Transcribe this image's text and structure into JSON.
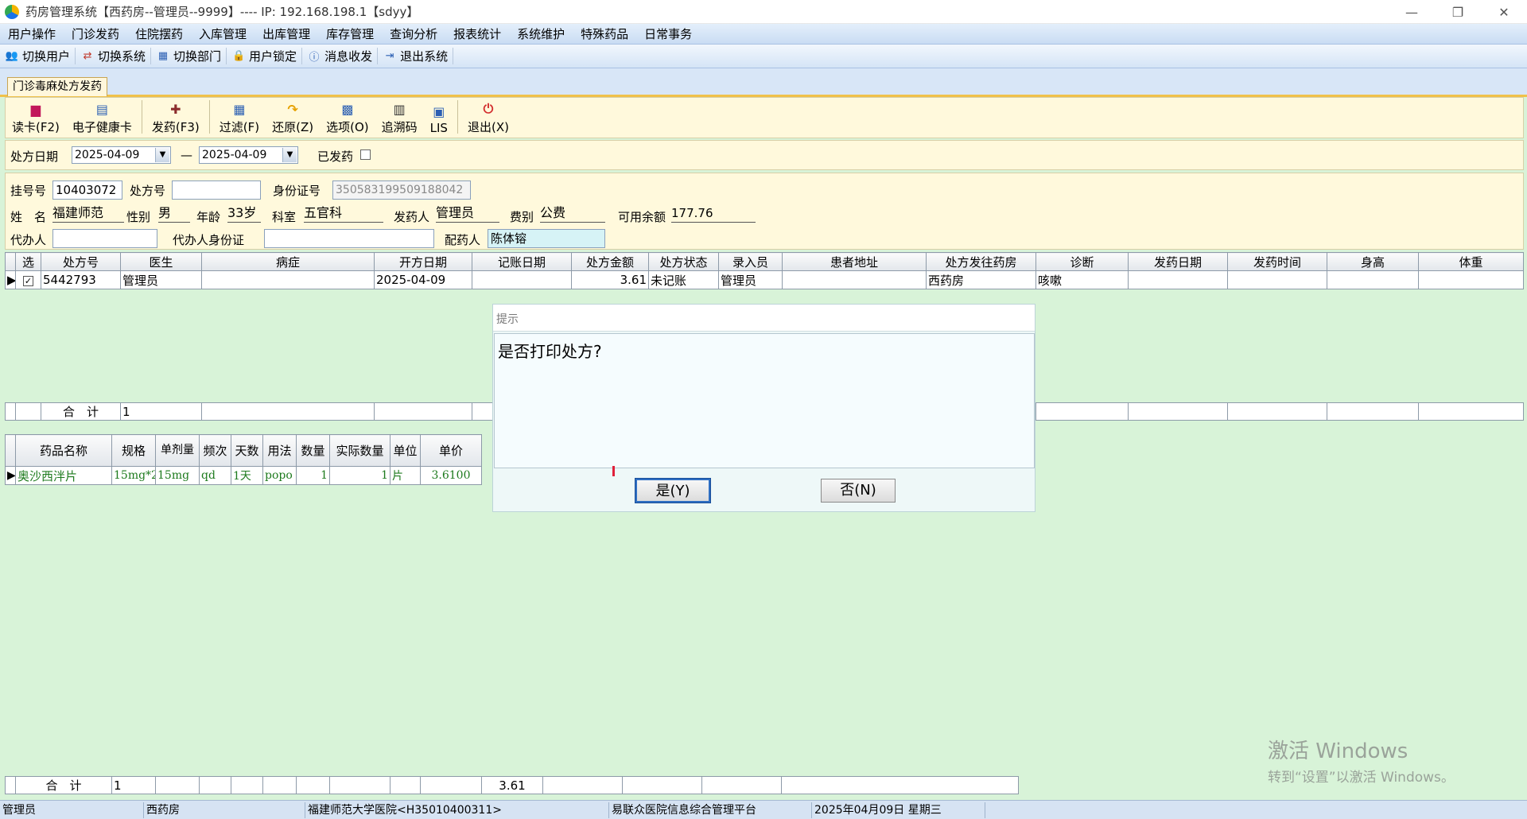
{
  "window": {
    "title": "药房管理系统【西药房--管理员--9999】---- IP: 192.168.198.1【sdyy】",
    "min": "—",
    "restore": "❐",
    "close": "✕"
  },
  "menu": [
    "用户操作",
    "门诊发药",
    "住院摆药",
    "入库管理",
    "出库管理",
    "库存管理",
    "查询分析",
    "报表统计",
    "系统维护",
    "特殊药品",
    "日常事务"
  ],
  "toolbar": [
    {
      "label": "切换用户",
      "icon": "users-icon"
    },
    {
      "label": "切换系统",
      "icon": "switch-system-icon"
    },
    {
      "label": "切换部门",
      "icon": "department-icon"
    },
    {
      "label": "用户锁定",
      "icon": "lock-user-icon"
    },
    {
      "label": "消息收发",
      "icon": "info-icon"
    },
    {
      "label": "退出系统",
      "icon": "exit-icon"
    }
  ],
  "tab": {
    "label": "门诊毒麻处方发药"
  },
  "actions": [
    {
      "label": "读卡(F2)",
      "icon": "card-reader-icon",
      "glyph": "▆",
      "color": "#c2185b"
    },
    {
      "label": "电子健康卡",
      "icon": "health-card-icon",
      "glyph": "▤",
      "color": "#2b5fb3"
    },
    {
      "label": "发药(F3)",
      "icon": "dispense-icon",
      "glyph": "✚",
      "color": "#8b2c2c"
    },
    {
      "label": "过滤(F)",
      "icon": "filter-icon",
      "glyph": "▦",
      "color": "#2b5fb3"
    },
    {
      "label": "还原(Z)",
      "icon": "restore-icon",
      "glyph": "↷",
      "color": "#e6a100"
    },
    {
      "label": "选项(O)",
      "icon": "options-icon",
      "glyph": "▩",
      "color": "#2b5fb3"
    },
    {
      "label": "追溯码",
      "icon": "barcode-icon",
      "glyph": "▥",
      "color": "#333"
    },
    {
      "label": "LIS",
      "icon": "lis-icon",
      "glyph": "▣",
      "color": "#2b5fb3"
    },
    {
      "label": "退出(X)",
      "icon": "power-icon",
      "glyph": "⏻",
      "color": "#d32f2f"
    }
  ],
  "filter": {
    "date_label": "处方日期",
    "date_from": "2025-04-09",
    "dash": "—",
    "date_to": "2025-04-09",
    "dispensed_label": "已发药"
  },
  "patient": {
    "reg_label": "挂号号",
    "reg_no": "10403072",
    "rx_label": "处方号",
    "rx_no": "",
    "id_label": "身份证号",
    "id_no": "350583199509188042",
    "name_label": "姓　名",
    "name": "福建师范",
    "sex_label": "性别",
    "sex": "男",
    "age_label": "年龄",
    "age": "33岁",
    "dept_label": "科室",
    "dept": "五官科",
    "dispenser_label": "发药人",
    "dispenser": "管理员",
    "fee_label": "费别",
    "fee": "公费",
    "balance_label": "可用余额",
    "balance": "177.76",
    "agent_label": "代办人",
    "agent": "",
    "agent_id_label": "代办人身份证",
    "agent_id": "",
    "pharmacist_label": "配药人",
    "pharmacist": "陈体镕"
  },
  "rx_table": {
    "headers": [
      "选",
      "处方号",
      "医生",
      "病症",
      "开方日期",
      "记账日期",
      "处方金额",
      "处方状态",
      "录入员",
      "患者地址",
      "处方发往药房",
      "诊断",
      "发药日期",
      "发药时间",
      "身高",
      "体重"
    ],
    "rows": [
      {
        "selected": "✓",
        "rx_no": "5442793",
        "doctor": "管理员",
        "disease": "",
        "open_date": "2025-04-09",
        "acct_date": "",
        "amount": "3.61",
        "status": "未记账",
        "entry": "管理员",
        "address": "",
        "pharmacy": "西药房",
        "diagnosis": "咳嗽",
        "disp_date": "",
        "disp_time": "",
        "height": "",
        "weight": ""
      }
    ],
    "sum_label": "合　计",
    "sum_count": "1"
  },
  "drug_table": {
    "headers": [
      "药品名称",
      "规格",
      "单剂量",
      "频次",
      "天数",
      "用法",
      "数量",
      "实际数量",
      "单位",
      "单价"
    ],
    "rows": [
      {
        "name": "奥沙西泮片",
        "spec": "15mg*2",
        "dose": "15mg",
        "freq": "qd",
        "days": "1天",
        "usage": "popo",
        "qty": "1",
        "actual": "1",
        "unit": "片",
        "price": "3.6100"
      }
    ],
    "sum_label": "合　计",
    "sum_count": "1",
    "sum_amount": "3.61"
  },
  "dialog": {
    "title": "提示",
    "message": "是否打印处方?",
    "yes": "是(Y)",
    "no": "否(N)"
  },
  "watermark": {
    "line1": "激活 Windows",
    "line2": "转到“设置”以激活 Windows。"
  },
  "status": [
    "管理员",
    "西药房",
    "福建师范大学医院<H35010400311>",
    "易联众医院信息综合管理平台",
    "2025年04月09日 星期三",
    ""
  ]
}
